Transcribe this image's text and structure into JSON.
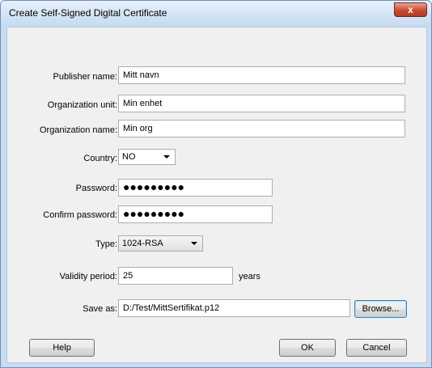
{
  "window": {
    "title": "Create Self-Signed Digital Certificate",
    "close_glyph": "x"
  },
  "form": {
    "publisher": {
      "label": "Publisher name:",
      "value": "Mitt navn"
    },
    "org_unit": {
      "label": "Organization unit:",
      "value": "Min enhet"
    },
    "org_name": {
      "label": "Organization name:",
      "value": "Min org"
    },
    "country": {
      "label": "Country:",
      "value": "NO"
    },
    "password": {
      "label": "Password:",
      "value": "●●●●●●●●●"
    },
    "confirm_password": {
      "label": "Confirm password:",
      "value": "●●●●●●●●●"
    },
    "type": {
      "label": "Type:",
      "value": "1024-RSA"
    },
    "validity": {
      "label": "Validity period:",
      "value": "25",
      "unit": "years"
    },
    "save_as": {
      "label": "Save as:",
      "value": "D:/Test/MittSertifikat.p12",
      "browse_label": "Browse..."
    }
  },
  "buttons": {
    "help": "Help",
    "ok": "OK",
    "cancel": "Cancel"
  }
}
